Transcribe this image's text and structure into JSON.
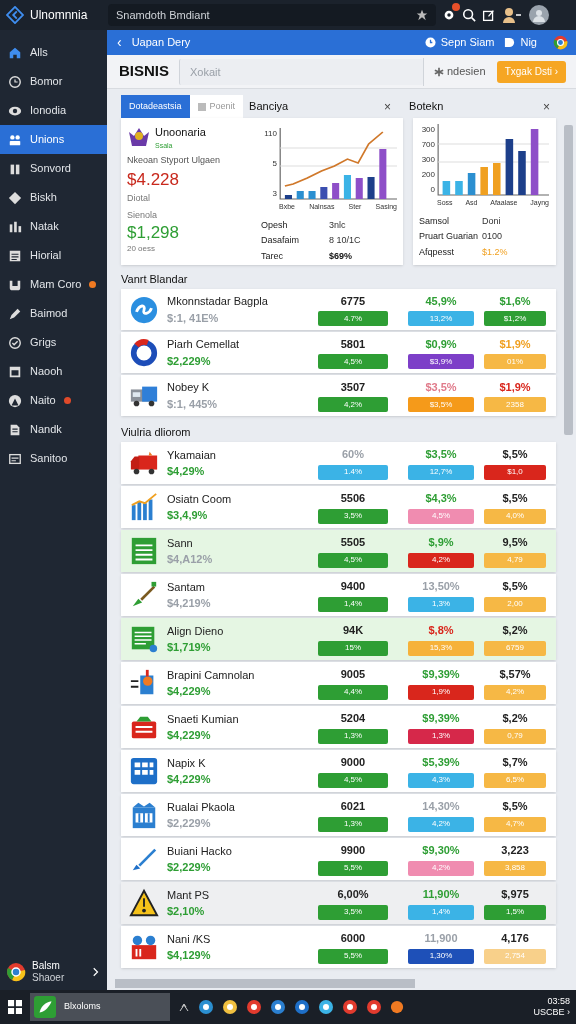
{
  "app": {
    "name": "Ulnomnnia",
    "search_value": "Snamdoth Bmdiant"
  },
  "sidebar": {
    "items": [
      {
        "label": "Alls",
        "selected": false
      },
      {
        "label": "Bomor",
        "selected": false
      },
      {
        "label": "Ionodia",
        "selected": false
      },
      {
        "label": "Unions",
        "selected": true
      },
      {
        "label": "Sonvord",
        "selected": false
      },
      {
        "label": "Biskh",
        "selected": false
      },
      {
        "label": "Natak",
        "selected": false
      },
      {
        "label": "Hiorial",
        "selected": false
      },
      {
        "label": "Mam Coro",
        "selected": false,
        "color": "#f07a22"
      },
      {
        "label": "Baimod",
        "selected": false
      },
      {
        "label": "Grigs",
        "selected": false
      },
      {
        "label": "Naooh",
        "selected": false
      },
      {
        "label": "Naito",
        "selected": false,
        "color": "#e04a2a"
      },
      {
        "label": "Nandk",
        "selected": false
      },
      {
        "label": "Sanitoo",
        "selected": false
      }
    ],
    "footer": {
      "title": "Balsm",
      "subtitle": "Shaoer"
    }
  },
  "header": {
    "back": "‹",
    "title": "Uapan Dery",
    "actions": [
      "Sepn Siam",
      "Nig"
    ]
  },
  "toolbar": {
    "title": "BISNIS",
    "search_placeholder": "Xokait",
    "filter": "ndesien",
    "button": "Txgak Dsti ›"
  },
  "tabs": [
    {
      "label": "Dotadeastsia",
      "selected": true
    },
    {
      "label": "Poenit",
      "selected": false
    }
  ],
  "cards": [
    {
      "title": "Banciya",
      "close": "×",
      "brand": "Unoonaria",
      "brand_sub": "Ssala",
      "caption": "Nkeoan Styport Ulgaen",
      "amount1": "$4.228",
      "label1": "Diotal",
      "label2": "Sienola",
      "amount2": "$1,298",
      "note": "20 oess",
      "y_labels": [
        "110",
        "5",
        "3"
      ],
      "x_labels": [
        "Bxbe",
        "Nalnsas",
        "Ster",
        "Sasing"
      ],
      "stats": [
        {
          "label": "Opesh",
          "value": "3nlc"
        },
        {
          "label": "Dasafaim",
          "value": "8 10/1C"
        },
        {
          "label": "Tarec",
          "value": "$69%"
        }
      ]
    },
    {
      "title": "Botekn",
      "close": "×",
      "y_labels": [
        "300",
        "700",
        "300",
        "200",
        "0"
      ],
      "x_labels": [
        "Soss",
        "Asd",
        "Afaalase",
        "Jayng"
      ],
      "stats": [
        {
          "label": "Samsol",
          "value": "Doni"
        },
        {
          "label": "Pruart Guarian",
          "value": "0100"
        },
        {
          "label": "Afqpesst",
          "value": "$1.2%"
        }
      ]
    }
  ],
  "sections": [
    {
      "title": "Vanrt Blandar",
      "rows": [
        {
          "name": "Mkonnstadar Bagpla",
          "sub": {
            "text": "$:1, 41E%",
            "color": "#9aa0a8"
          },
          "cells": [
            {
              "value": {
                "text": "6775",
                "color": "#222222"
              },
              "tag": {
                "text": "4.7%",
                "color": "#2e9e34"
              }
            },
            {
              "value": {
                "text": "45,9%",
                "color": "#2e9e34"
              },
              "tag": {
                "text": "13,2%",
                "color": "#3bb3e6"
              }
            },
            {
              "value": {
                "text": "$1,6%",
                "color": "#2e9e34"
              },
              "tag": {
                "text": "$1,2%",
                "color": "#2e9e34"
              }
            }
          ]
        },
        {
          "name": "Piarh Cemellat",
          "sub": {
            "text": "$2,229%",
            "color": "#2e9e34"
          },
          "cells": [
            {
              "value": {
                "text": "5801",
                "color": "#222222"
              },
              "tag": {
                "text": "4,5%",
                "color": "#2e9e34"
              }
            },
            {
              "value": {
                "text": "$0,9%",
                "color": "#2e9e34"
              },
              "tag": {
                "text": "$3,9%",
                "color": "#7d3fc8"
              }
            },
            {
              "value": {
                "text": "$1,9%",
                "color": "#f0a020"
              },
              "tag": {
                "text": "01%",
                "color": "#f6b845"
              }
            }
          ]
        },
        {
          "name": "Nobey K",
          "sub": {
            "text": "$:1, 445%",
            "color": "#9aa0a8"
          },
          "cells": [
            {
              "value": {
                "text": "3507",
                "color": "#222222"
              },
              "tag": {
                "text": "4,2%",
                "color": "#2e9e34"
              }
            },
            {
              "value": {
                "text": "$3,5%",
                "color": "#e07a8a"
              },
              "tag": {
                "text": "$3,5%",
                "color": "#f59a1a"
              }
            },
            {
              "value": {
                "text": "$1,9%",
                "color": "#d9261c"
              },
              "tag": {
                "text": "2358",
                "color": "#f6b845"
              }
            }
          ]
        }
      ]
    },
    {
      "title": "Viulria dliorom",
      "rows": [
        {
          "name": "Ykamaian",
          "sub": {
            "text": "$4,29%",
            "color": "#2e9e34"
          },
          "cells": [
            {
              "value": {
                "text": "60%",
                "color": "#9aa0a8"
              },
              "tag": {
                "text": "1.4%",
                "color": "#3bb3e6"
              }
            },
            {
              "value": {
                "text": "$3,5%",
                "color": "#2e9e34"
              },
              "tag": {
                "text": "12,7%",
                "color": "#3bb3e6"
              }
            },
            {
              "value": {
                "text": "$,5%",
                "color": "#222222"
              },
              "tag": {
                "text": "$1,0",
                "color": "#d9261c"
              }
            }
          ]
        },
        {
          "name": "Osiatn Coom",
          "sub": {
            "text": "$3,4,9%",
            "color": "#2e9e34"
          },
          "cells": [
            {
              "value": {
                "text": "5506",
                "color": "#222222"
              },
              "tag": {
                "text": "3,5%",
                "color": "#2e9e34"
              }
            },
            {
              "value": {
                "text": "$4,3%",
                "color": "#2e9e34"
              },
              "tag": {
                "text": "4,5%",
                "color": "#f08cb0"
              }
            },
            {
              "value": {
                "text": "$,5%",
                "color": "#222222"
              },
              "tag": {
                "text": "4,0%",
                "color": "#f6b845"
              }
            }
          ]
        },
        {
          "name": "Sann",
          "sub": {
            "text": "$4,A12%",
            "color": "#9aa0a8"
          },
          "highlight": {
            "color": "#e5f6e3"
          },
          "cells": [
            {
              "value": {
                "text": "5505",
                "color": "#222222"
              },
              "tag": {
                "text": "4,5%",
                "color": "#2e9e34"
              }
            },
            {
              "value": {
                "text": "$,9%",
                "color": "#2e9e34"
              },
              "tag": {
                "text": "4,2%",
                "color": "#d9261c"
              }
            },
            {
              "value": {
                "text": "9,5%",
                "color": "#222222"
              },
              "tag": {
                "text": "4,79",
                "color": "#f6b845"
              }
            }
          ]
        },
        {
          "name": "Santam",
          "sub": {
            "text": "$4,219%",
            "color": "#9aa0a8"
          },
          "cells": [
            {
              "value": {
                "text": "9400",
                "color": "#222222"
              },
              "tag": {
                "text": "1,4%",
                "color": "#2e9e34"
              }
            },
            {
              "value": {
                "text": "13,50%",
                "color": "#9aa0a8"
              },
              "tag": {
                "text": "1,3%",
                "color": "#3bb3e6"
              }
            },
            {
              "value": {
                "text": "$,5%",
                "color": "#222222"
              },
              "tag": {
                "text": "2,00",
                "color": "#f6b845"
              }
            }
          ]
        },
        {
          "name": "Align Dieno",
          "sub": {
            "text": "$1,719%",
            "color": "#2e9e34"
          },
          "highlight": {
            "color": "#e5f6e3"
          },
          "cells": [
            {
              "value": {
                "text": "94K",
                "color": "#222222"
              },
              "tag": {
                "text": "15%",
                "color": "#2e9e34"
              }
            },
            {
              "value": {
                "text": "$,8%",
                "color": "#d9261c"
              },
              "tag": {
                "text": "15,3%",
                "color": "#f6b23a"
              }
            },
            {
              "value": {
                "text": "$,2%",
                "color": "#222222"
              },
              "tag": {
                "text": "6759",
                "color": "#f6b845"
              }
            }
          ]
        },
        {
          "name": "Brapini Camnolan",
          "sub": {
            "text": "$4,229%",
            "color": "#2e9e34"
          },
          "cells": [
            {
              "value": {
                "text": "9005",
                "color": "#222222"
              },
              "tag": {
                "text": "4,4%",
                "color": "#2e9e34"
              }
            },
            {
              "value": {
                "text": "$9,39%",
                "color": "#2e9e34"
              },
              "tag": {
                "text": "1,9%",
                "color": "#d9261c"
              }
            },
            {
              "value": {
                "text": "$,57%",
                "color": "#222222"
              },
              "tag": {
                "text": "4,2%",
                "color": "#f6b845"
              }
            }
          ]
        },
        {
          "name": "Snaeti Kumian",
          "sub": {
            "text": "$4,229%",
            "color": "#2e9e34"
          },
          "cells": [
            {
              "value": {
                "text": "5204",
                "color": "#222222"
              },
              "tag": {
                "text": "1,3%",
                "color": "#2e9e34"
              }
            },
            {
              "value": {
                "text": "$9,39%",
                "color": "#2e9e34"
              },
              "tag": {
                "text": "1,3%",
                "color": "#d6284a"
              }
            },
            {
              "value": {
                "text": "$,2%",
                "color": "#222222"
              },
              "tag": {
                "text": "0,79",
                "color": "#f6b845"
              }
            }
          ]
        },
        {
          "name": "Napix K",
          "sub": {
            "text": "$4,229%",
            "color": "#2e9e34"
          },
          "cells": [
            {
              "value": {
                "text": "9000",
                "color": "#222222"
              },
              "tag": {
                "text": "4,5%",
                "color": "#2e9e34"
              }
            },
            {
              "value": {
                "text": "$5,39%",
                "color": "#2e9e34"
              },
              "tag": {
                "text": "4,3%",
                "color": "#3bb3e6"
              }
            },
            {
              "value": {
                "text": "$,7%",
                "color": "#222222"
              },
              "tag": {
                "text": "6,5%",
                "color": "#f6b845"
              }
            }
          ]
        },
        {
          "name": "Rualai Pkaola",
          "sub": {
            "text": "$2,229%",
            "color": "#9aa0a8"
          },
          "cells": [
            {
              "value": {
                "text": "6021",
                "color": "#222222"
              },
              "tag": {
                "text": "1,3%",
                "color": "#2e9e34"
              }
            },
            {
              "value": {
                "text": "14,30%",
                "color": "#9aa0a8"
              },
              "tag": {
                "text": "4,2%",
                "color": "#3bb3e6"
              }
            },
            {
              "value": {
                "text": "$,5%",
                "color": "#222222"
              },
              "tag": {
                "text": "4,7%",
                "color": "#f6b845"
              }
            }
          ]
        },
        {
          "name": "Buiani Hacko",
          "sub": {
            "text": "$2,229%",
            "color": "#2e9e34"
          },
          "cells": [
            {
              "value": {
                "text": "9900",
                "color": "#222222"
              },
              "tag": {
                "text": "5,5%",
                "color": "#2e9e34"
              }
            },
            {
              "value": {
                "text": "$9,30%",
                "color": "#2e9e34"
              },
              "tag": {
                "text": "4,2%",
                "color": "#f08cb0"
              }
            },
            {
              "value": {
                "text": "3,223",
                "color": "#222222"
              },
              "tag": {
                "text": "3,858",
                "color": "#f6b845"
              }
            }
          ]
        },
        {
          "name": "Mant PS",
          "sub": {
            "text": "$2,10%",
            "color": "#2e9e34"
          },
          "highlight": {
            "color": "#eeeff1"
          },
          "cells": [
            {
              "value": {
                "text": "6,00%",
                "color": "#222222"
              },
              "tag": {
                "text": "3,5%",
                "color": "#2e9e34"
              }
            },
            {
              "value": {
                "text": "11,90%",
                "color": "#2e9e34"
              },
              "tag": {
                "text": "1,4%",
                "color": "#3bb3e6"
              }
            },
            {
              "value": {
                "text": "$,975",
                "color": "#222222"
              },
              "tag": {
                "text": "1,5%",
                "color": "#2e9e34"
              }
            }
          ]
        },
        {
          "name": "Nani /KS",
          "sub": {
            "text": "$4,129%",
            "color": "#2e9e34"
          },
          "cells": [
            {
              "value": {
                "text": "6000",
                "color": "#222222"
              },
              "tag": {
                "text": "5,5%",
                "color": "#2e9e34"
              }
            },
            {
              "value": {
                "text": "11,900",
                "color": "#9aa0a8"
              },
              "tag": {
                "text": "1,30%",
                "color": "#1e50b8"
              }
            },
            {
              "value": {
                "text": "4,176",
                "color": "#222222"
              },
              "tag": {
                "text": "2,754",
                "color": "#f8d08a"
              }
            }
          ]
        }
      ]
    }
  ],
  "taskbar": {
    "app": "Blxoloms",
    "time": "03:58",
    "date": "USCBE ›"
  }
}
